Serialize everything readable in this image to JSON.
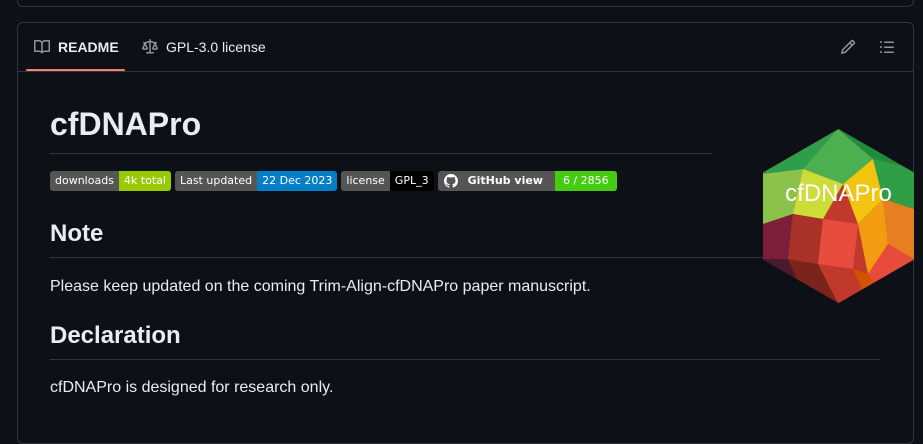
{
  "tabs": {
    "readme_label": "README",
    "license_label": "GPL-3.0 license"
  },
  "readme": {
    "title": "cfDNAPro",
    "badges": [
      {
        "label": "downloads",
        "value": "4k total",
        "label_color": "#555555",
        "value_color": "#97ca00"
      },
      {
        "label": "Last updated",
        "value": "22 Dec 2023",
        "label_color": "#555555",
        "value_color": "#007ec6"
      },
      {
        "label": "license",
        "value": "GPL_3",
        "label_color": "#555555",
        "value_color": "#000000"
      },
      {
        "label": "GitHub view",
        "value": "6 / 2856",
        "label_color": "#555555",
        "value_color": "#4c1",
        "icon": "github-icon"
      }
    ],
    "sections": [
      {
        "heading": "Note",
        "text": "Please keep updated on the coming Trim-Align-cfDNAPro paper manuscript."
      },
      {
        "heading": "Declaration",
        "text": "cfDNAPro is designed for research only."
      }
    ],
    "logo_text": "cfDNAPro"
  },
  "colors": {
    "background": "#0d1117",
    "border": "#30363d",
    "text": "#e6edf3",
    "muted_icon": "#8b949e",
    "tab_underline": "#f78166"
  }
}
